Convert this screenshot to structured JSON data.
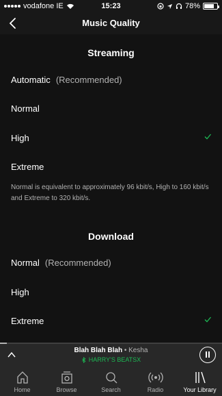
{
  "status_bar": {
    "carrier": "vodafone IE",
    "time": "15:23",
    "battery": "78%",
    "battery_level": 0.78
  },
  "header": {
    "title": "Music Quality"
  },
  "streaming": {
    "title": "Streaming",
    "options": [
      {
        "label": "Automatic",
        "note": "(Recommended)",
        "selected": false
      },
      {
        "label": "Normal",
        "note": "",
        "selected": false
      },
      {
        "label": "High",
        "note": "",
        "selected": true
      },
      {
        "label": "Extreme",
        "note": "",
        "selected": false
      }
    ],
    "description": "Normal is equivalent to approximately 96 kbit/s, High to 160 kbit/s and Extreme to 320 kbit/s."
  },
  "download": {
    "title": "Download",
    "options": [
      {
        "label": "Normal",
        "note": "(Recommended)",
        "selected": false
      },
      {
        "label": "High",
        "note": "",
        "selected": false
      },
      {
        "label": "Extreme",
        "note": "",
        "selected": true
      }
    ]
  },
  "now_playing": {
    "title": "Blah Blah Blah",
    "separator": "•",
    "artist": "Kesha",
    "device": "HARRY'S BEATSX",
    "progress": 0.03
  },
  "tabs": [
    {
      "label": "Home",
      "active": false
    },
    {
      "label": "Browse",
      "active": false
    },
    {
      "label": "Search",
      "active": false
    },
    {
      "label": "Radio",
      "active": false
    },
    {
      "label": "Your Library",
      "active": true
    }
  ],
  "colors": {
    "accent": "#1db954",
    "background": "#121212",
    "bar": "#282828"
  }
}
